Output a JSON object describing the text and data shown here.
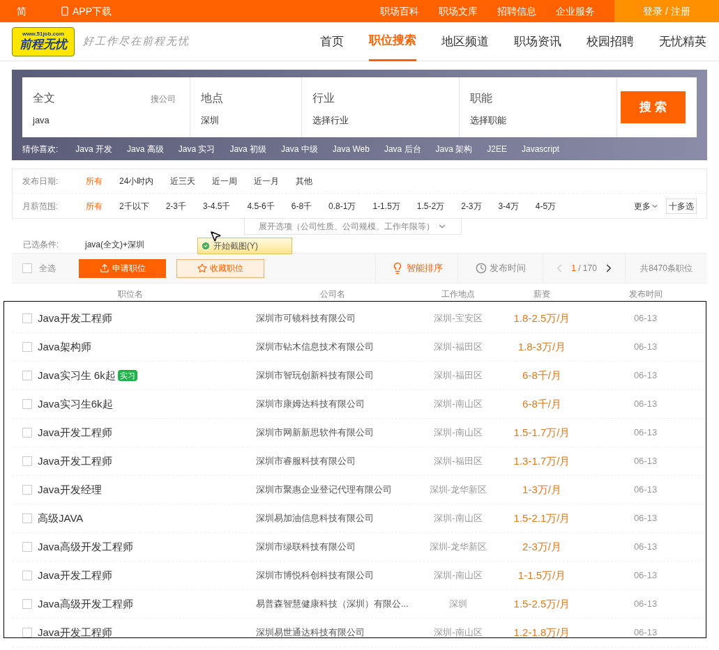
{
  "top_bar": {
    "lang": "简",
    "app": "APP下载",
    "links": [
      "职场百科",
      "职场文库",
      "招聘信息",
      "企业服务"
    ],
    "login": "登录 / 注册"
  },
  "header": {
    "logo_url": "www.51job.com",
    "logo_text": "前程无忧",
    "slogan": "好工作尽在前程无忧",
    "nav": [
      {
        "label": "首页",
        "selected": false
      },
      {
        "label": "职位搜索",
        "selected": true
      },
      {
        "label": "地区频道",
        "selected": false
      },
      {
        "label": "职场资讯",
        "selected": false
      },
      {
        "label": "校园招聘",
        "selected": false
      },
      {
        "label": "无忧精英",
        "selected": false
      }
    ]
  },
  "search": {
    "fields": [
      {
        "label": "全文",
        "value": "java",
        "extra": "搜公司"
      },
      {
        "label": "地点",
        "value": "深圳"
      },
      {
        "label": "行业",
        "value": "选择行业"
      },
      {
        "label": "职能",
        "value": "选择职能"
      }
    ],
    "button": "搜 索",
    "guess_label": "猜你喜欢:",
    "guesses": [
      "Java 开发",
      "Java 高级",
      "Java 实习",
      "Java 初级",
      "Java 中级",
      "Java Web",
      "Java 后台",
      "Java 架构",
      "J2EE",
      "Javascript"
    ]
  },
  "filters": [
    {
      "label": "发布日期:",
      "options": [
        {
          "label": "所有",
          "selected": true
        },
        {
          "label": "24小时内",
          "selected": false
        },
        {
          "label": "近三天",
          "selected": false
        },
        {
          "label": "近一周",
          "selected": false
        },
        {
          "label": "近一月",
          "selected": false
        },
        {
          "label": "其他",
          "selected": false
        }
      ]
    },
    {
      "label": "月薪范围:",
      "options": [
        {
          "label": "所有",
          "selected": true
        },
        {
          "label": "2千以下",
          "selected": false
        },
        {
          "label": "2-3千",
          "selected": false
        },
        {
          "label": "3-4.5千",
          "selected": false
        },
        {
          "label": "4.5-6千",
          "selected": false
        },
        {
          "label": "6-8千",
          "selected": false
        },
        {
          "label": "0.8-1万",
          "selected": false
        },
        {
          "label": "1-1.5万",
          "selected": false
        },
        {
          "label": "1.5-2万",
          "selected": false
        },
        {
          "label": "2-3万",
          "selected": false
        },
        {
          "label": "3-4万",
          "selected": false
        },
        {
          "label": "4-5万",
          "selected": false
        }
      ],
      "more": "更多",
      "multi": "十多选"
    }
  ],
  "expand": "展开选项（公司性质、公司规模、工作年限等）",
  "selected_conditions": {
    "label": "已选条件:",
    "value": "java(全文)+深圳"
  },
  "tooltip": "开始截图(Y)",
  "toolbar": {
    "select_all": "全选",
    "select_all_checked": false,
    "apply": "申请职位",
    "favorite": "收藏职位",
    "sort_smart": "智能排序",
    "sort_time": "发布时间",
    "page_current": "1",
    "page_total": "/ 170",
    "total": "共8470条职位"
  },
  "table": {
    "columns": [
      "职位名",
      "公司名",
      "工作地点",
      "薪资",
      "发布时间"
    ],
    "rows": [
      {
        "title": "Java开发工程师",
        "company": "深圳市可镜科技有限公司",
        "location": "深圳-宝安区",
        "salary": "1.8-2.5万/月",
        "date": "06-13",
        "checked": false
      },
      {
        "title": "Java架构师",
        "company": "深圳市钻木信息技术有限公司",
        "location": "深圳-福田区",
        "salary": "1.8-3万/月",
        "date": "06-13",
        "checked": false
      },
      {
        "title": "Java实习生 6k起",
        "tag": "实习",
        "company": "深圳市智玩创新科技有限公司",
        "location": "深圳-福田区",
        "salary": "6-8千/月",
        "date": "06-13",
        "checked": false
      },
      {
        "title": "Java实习生6k起",
        "company": "深圳市康姆达科技有限公司",
        "location": "深圳-南山区",
        "salary": "6-8千/月",
        "date": "06-13",
        "checked": false
      },
      {
        "title": "Java开发工程师",
        "company": "深圳市网新新思软件有限公司",
        "location": "深圳-南山区",
        "salary": "1.5-1.7万/月",
        "date": "06-13",
        "checked": false
      },
      {
        "title": "Java开发工程师",
        "company": "深圳市睿服科技有限公司",
        "location": "深圳-福田区",
        "salary": "1.3-1.7万/月",
        "date": "06-13",
        "checked": false
      },
      {
        "title": "Java开发经理",
        "company": "深圳市聚惠企业登记代理有限公司",
        "location": "深圳-龙华新区",
        "salary": "1-3万/月",
        "date": "06-13",
        "checked": false
      },
      {
        "title": "高级JAVA",
        "company": "深圳易加油信息科技有限公司",
        "location": "深圳-南山区",
        "salary": "1.5-2.1万/月",
        "date": "06-13",
        "checked": false
      },
      {
        "title": "Java高级开发工程师",
        "company": "深圳市绿联科技有限公司",
        "location": "深圳-龙华新区",
        "salary": "2-3万/月",
        "date": "06-13",
        "checked": false
      },
      {
        "title": "Java开发工程师",
        "company": "深圳市博悦科创科技有限公司",
        "location": "深圳-南山区",
        "salary": "1-1.5万/月",
        "date": "06-13",
        "checked": false
      },
      {
        "title": "Java高级开发工程师",
        "company": "易普森智慧健康科技（深圳）有限公...",
        "location": "深圳",
        "salary": "1.5-2.5万/月",
        "date": "06-13",
        "checked": false
      },
      {
        "title": "Java开发工程师",
        "company": "深圳易世通达科技有限公司",
        "location": "深圳-南山区",
        "salary": "1.2-1.8万/月",
        "date": "06-13",
        "checked": false
      }
    ]
  }
}
